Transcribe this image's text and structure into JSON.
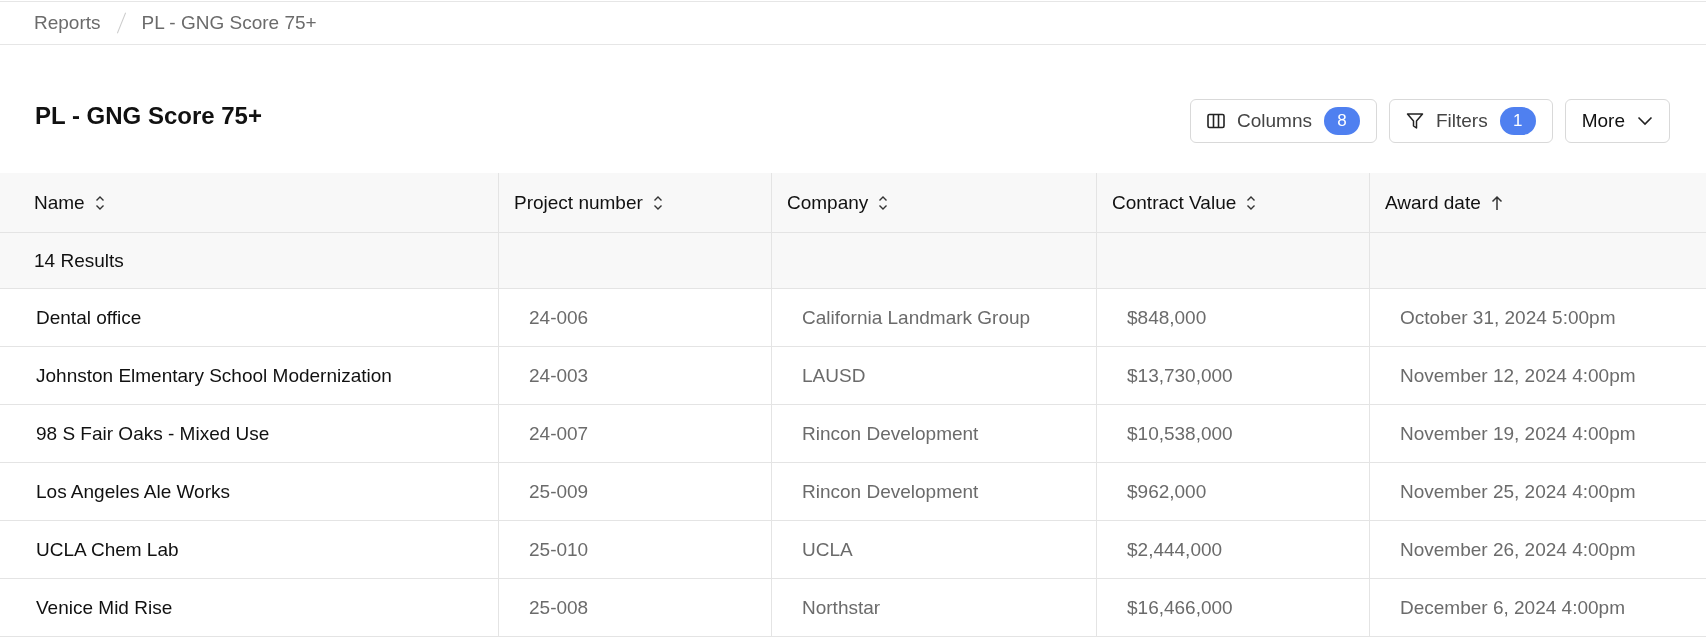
{
  "breadcrumb": [
    "Reports",
    "PL - GNG Score 75+"
  ],
  "title": "PL - GNG Score 75+",
  "toolbar": [
    {
      "kind": "columns",
      "label": "Columns",
      "badge": "8"
    },
    {
      "kind": "filter",
      "label": "Filters",
      "badge": "1"
    },
    {
      "kind": "more",
      "label": "More"
    }
  ],
  "table": {
    "columns": [
      {
        "label": "Name",
        "kind": "sortable"
      },
      {
        "label": "Project number",
        "kind": "sortable"
      },
      {
        "label": "Company",
        "kind": "sortable"
      },
      {
        "label": "Contract Value",
        "kind": "sortable"
      },
      {
        "label": "Award date",
        "kind": "ascending"
      }
    ],
    "summary": "14 Results",
    "rows": [
      [
        "Dental office",
        "24-006",
        "California Landmark Group",
        "$848,000",
        "October 31, 2024 5:00pm"
      ],
      [
        "Johnston Elmentary School Modernization",
        "24-003",
        "LAUSD",
        "$13,730,000",
        "November 12, 2024 4:00pm"
      ],
      [
        "98 S Fair Oaks - Mixed Use",
        "24-007",
        "Rincon Development",
        "$10,538,000",
        "November 19, 2024 4:00pm"
      ],
      [
        "Los Angeles Ale Works",
        "25-009",
        "Rincon Development",
        "$962,000",
        "November 25, 2024 4:00pm"
      ],
      [
        "UCLA Chem Lab",
        "25-010",
        "UCLA",
        "$2,444,000",
        "November 26, 2024 4:00pm"
      ],
      [
        "Venice Mid Rise",
        "25-008",
        "Northstar",
        "$16,466,000",
        "December 6, 2024 4:00pm"
      ]
    ]
  }
}
